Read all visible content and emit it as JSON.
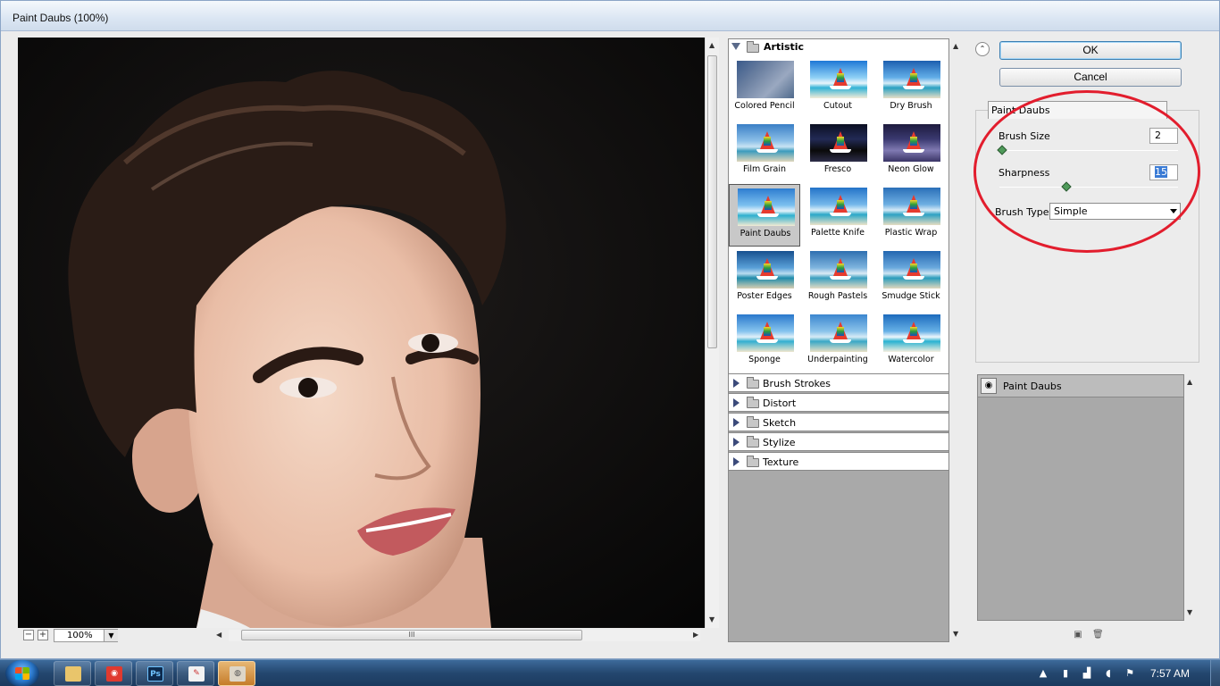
{
  "window": {
    "title": "Paint Daubs (100%)"
  },
  "preview": {
    "zoom": "100%",
    "zoom_out": "−",
    "zoom_in": "+",
    "scroll_grip": "III"
  },
  "gallery": {
    "open_category": "Artistic",
    "filters": [
      {
        "label": "Colored Pencil"
      },
      {
        "label": "Cutout"
      },
      {
        "label": "Dry Brush"
      },
      {
        "label": "Film Grain"
      },
      {
        "label": "Fresco"
      },
      {
        "label": "Neon Glow"
      },
      {
        "label": "Paint Daubs"
      },
      {
        "label": "Palette Knife"
      },
      {
        "label": "Plastic Wrap"
      },
      {
        "label": "Poster Edges"
      },
      {
        "label": "Rough Pastels"
      },
      {
        "label": "Smudge Stick"
      },
      {
        "label": "Sponge"
      },
      {
        "label": "Underpainting"
      },
      {
        "label": "Watercolor"
      }
    ],
    "selected_filter": "Paint Daubs",
    "collapsed_categories": [
      "Brush Strokes",
      "Distort",
      "Sketch",
      "Stylize",
      "Texture"
    ]
  },
  "buttons": {
    "ok": "OK",
    "cancel": "Cancel",
    "collapse": "⌃"
  },
  "options": {
    "title": "Paint Daubs",
    "brush_size_label": "Brush Size",
    "brush_size_value": "2",
    "brush_size_level": 0.0,
    "sharpness_label": "Sharpness",
    "sharpness_value": "15",
    "sharpness_level": 0.375,
    "brush_type_label": "Brush Type:",
    "brush_type_value": "Simple"
  },
  "layers": {
    "items": [
      {
        "label": "Paint Daubs"
      }
    ]
  },
  "taskbar": {
    "apps": [
      "explorer",
      "red-app",
      "photoshop",
      "paint-tool",
      "active-app"
    ],
    "photoshop_label": "Ps",
    "clock": "7:57 AM"
  },
  "colors": {
    "highlight_oval": "#e21d2d",
    "selection": "#3a7bd5"
  }
}
